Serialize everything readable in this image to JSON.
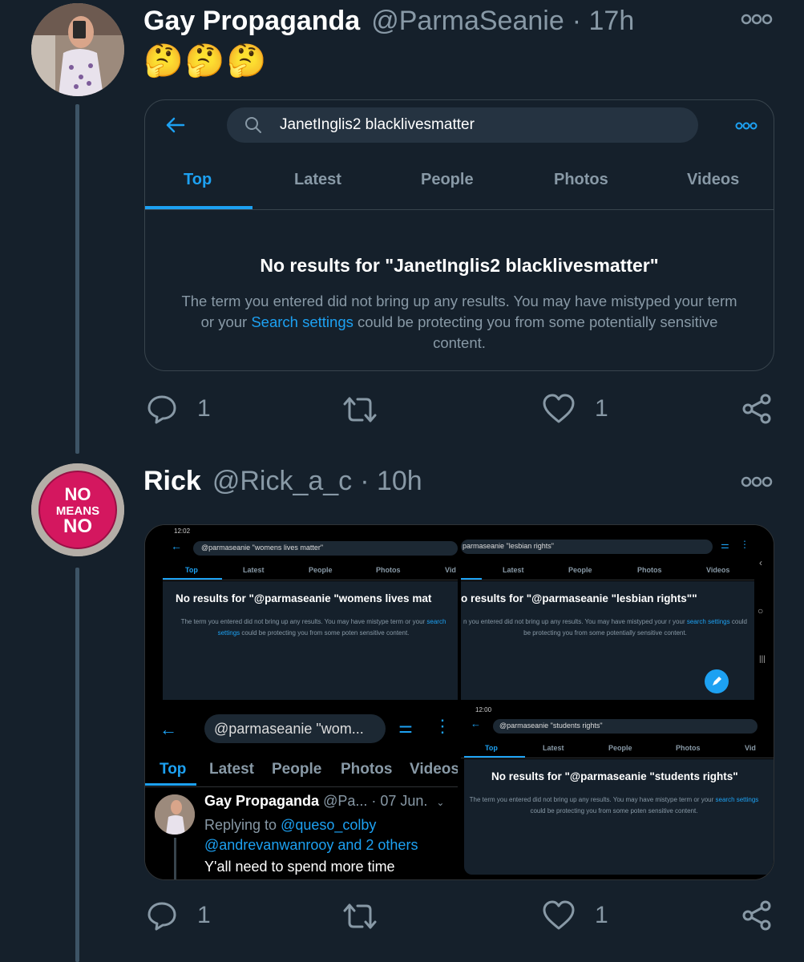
{
  "colors": {
    "bg": "#15202b",
    "accent": "#1da1f2",
    "muted": "#8899a6",
    "border": "#38444d",
    "search_bg": "#253341"
  },
  "tweet1": {
    "name": "Gay Propaganda",
    "handle": "@ParmaSeanie",
    "time": "· 17h",
    "emoji": "🤔🤔🤔",
    "card": {
      "search_query": "JanetInglis2 blacklivesmatter",
      "tabs": [
        "Top",
        "Latest",
        "People",
        "Photos",
        "Videos"
      ],
      "no_results_title": "No results for \"JanetInglis2 blacklivesmatter\"",
      "body_pre": "The term you entered did not bring up any results. You may have mistyped your term or your ",
      "body_link": "Search settings",
      "body_post": " could be protecting you from some potentially sensitive content."
    },
    "replies": "1",
    "likes": "1"
  },
  "tweet2": {
    "name": "Rick",
    "handle": "@Rick_a_c",
    "time": "· 10h",
    "badge_text": [
      "NO",
      "MEANS",
      "NO"
    ],
    "grid": {
      "tl": {
        "status_time": "12:02",
        "query": "@parmaseanie \"womens lives matter\"",
        "tabs": [
          "Top",
          "Latest",
          "People",
          "Photos",
          "Vid"
        ],
        "title": "No results for \"@parmaseanie \"womens lives mat",
        "body_pre": "The term you entered did not bring up any results. You may have mistype term or your ",
        "body_link": "search settings",
        "body_post": " could be protecting you from some poten sensitive content."
      },
      "tr": {
        "query": "parmaseanie \"lesbian rights\"",
        "tabs": [
          "Latest",
          "People",
          "Photos",
          "Videos"
        ],
        "title": "o results for \"@parmaseanie \"lesbian rights\"\"",
        "body_pre": "n you entered did not bring up any results. You may have mistyped your r your ",
        "body_link": "search settings",
        "body_post": " could be protecting you from some potentially sensitive content."
      },
      "bl": {
        "query": "@parmaseanie \"wom...",
        "tabs": [
          "Top",
          "Latest",
          "People",
          "Photos",
          "Videos"
        ],
        "tweet_name": "Gay Propaganda",
        "tweet_handle_time": "@Pa... · 07 Jun.",
        "replying_to_pre": "Replying to ",
        "replying_to_link1": "@queso_colby",
        "replying_to_link2": "@andrevanwanrooy and 2 others",
        "tweet_text": "Y'all need to spend more time"
      },
      "br": {
        "status_time": "12:00",
        "query": "@parmaseanie \"students rights\"",
        "tabs": [
          "Top",
          "Latest",
          "People",
          "Photos",
          "Vid"
        ],
        "title": "No results for \"@parmaseanie \"students rights\"",
        "body_pre": "The term you entered did not bring up any results. You may have mistype term or your ",
        "body_link": "search settings",
        "body_post": " could be protecting you from some poten sensitive content."
      }
    },
    "replies": "1",
    "likes": "1"
  }
}
